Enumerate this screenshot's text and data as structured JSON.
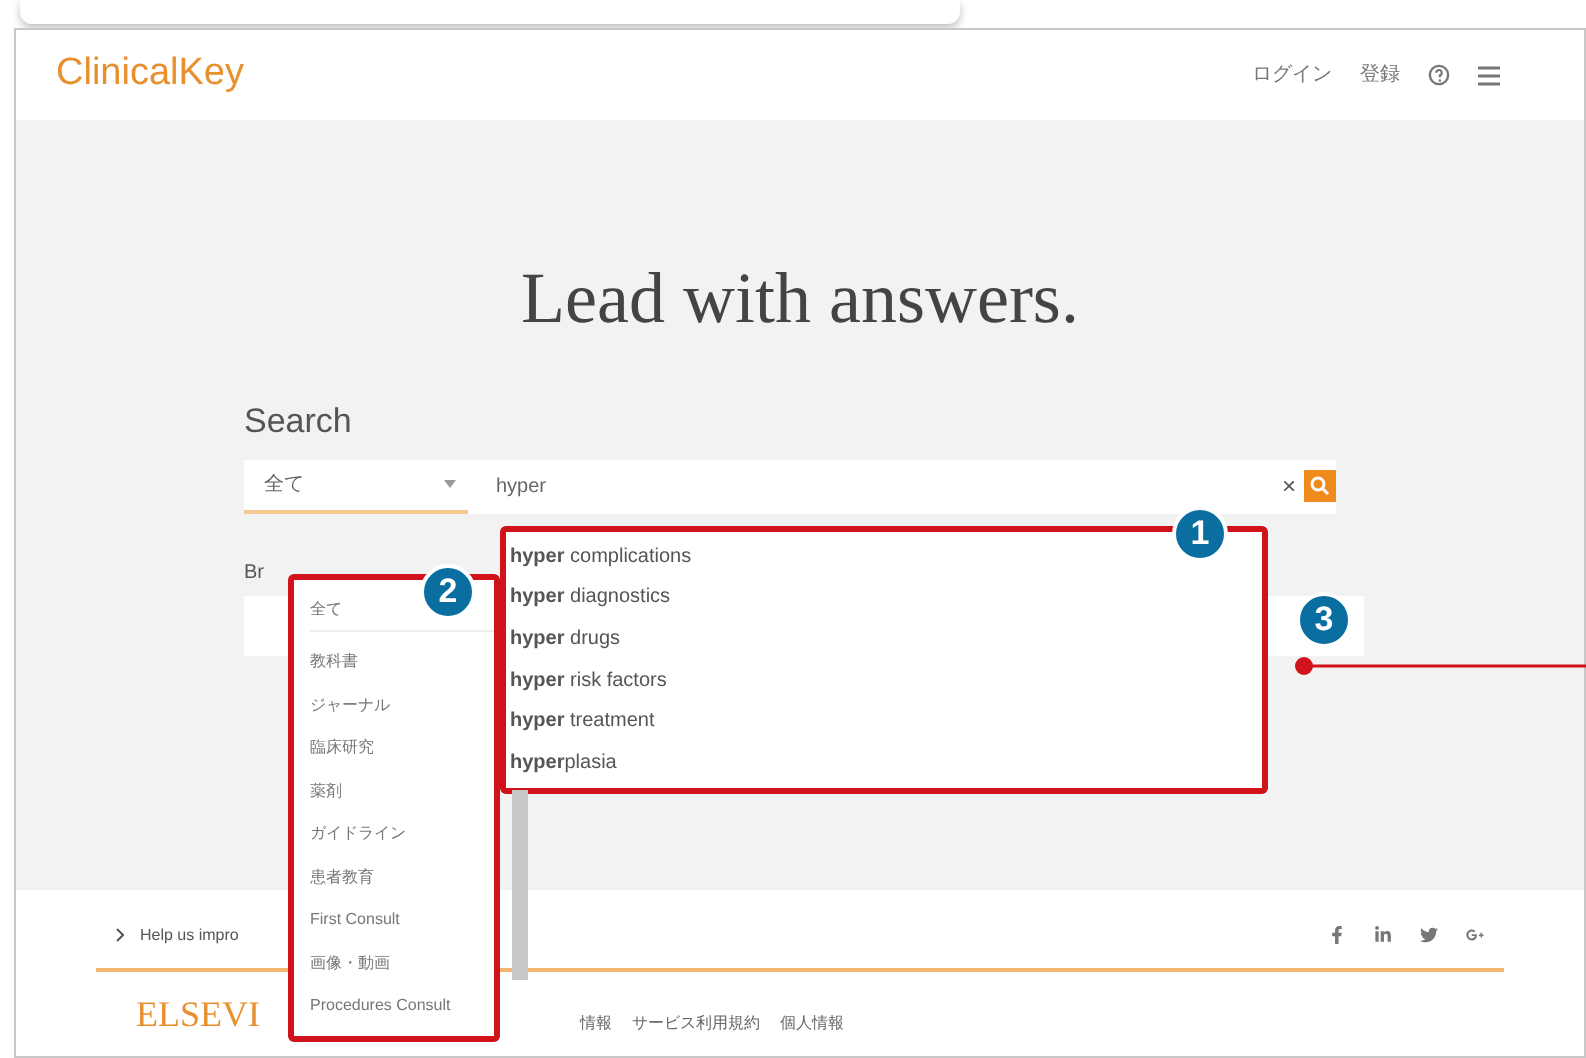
{
  "header": {
    "logo": "ClinicalKey",
    "links": [
      "ログイン",
      "登録"
    ]
  },
  "hero": {
    "headline": "Lead with answers."
  },
  "search": {
    "label": "Search",
    "category": "全て",
    "query": "hyper",
    "clear": "×"
  },
  "browse_label": "Br",
  "suggestions": [
    "**hyper** complications",
    "**hyper** diagnostics",
    "**hyper** drugs",
    "**hyper** risk factors",
    "**hyper** treatment",
    "**hyper**plasia"
  ],
  "categories": [
    "全て",
    "教科書",
    "ジャーナル",
    "臨床研究",
    "薬剤",
    "ガイドライン",
    "患者教育",
    "First Consult",
    "画像・動画",
    "Procedures Consult"
  ],
  "footer": {
    "feedback": "Help us impro",
    "brand": "ELSEVI",
    "links": [
      "情報",
      "サービス利用規約",
      "個人情報"
    ]
  },
  "callouts": [
    "1",
    "2",
    "3"
  ]
}
